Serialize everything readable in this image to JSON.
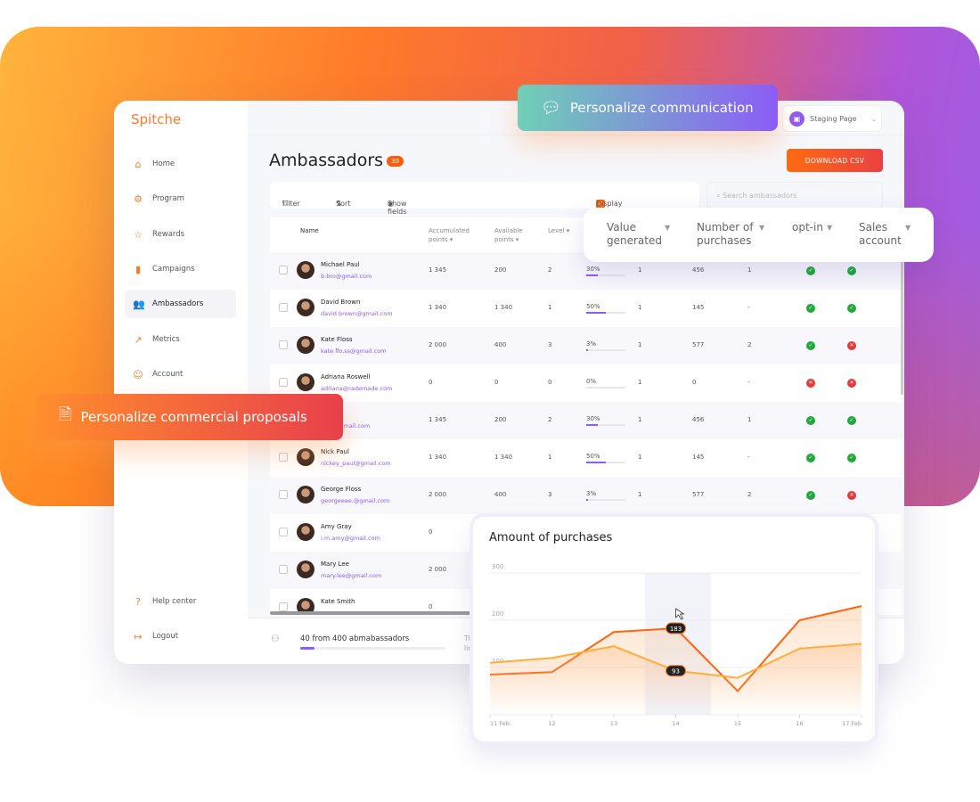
{
  "banners": {
    "communication": "Personalize communication",
    "proposals": "Personalize commercial proposals"
  },
  "app": {
    "logo": "Spitche",
    "staging": "Staging Page",
    "title": "Ambassadors",
    "count": "30",
    "download": "DOWNLOAD CSV"
  },
  "sidebar": {
    "items": [
      {
        "label": "Home",
        "icon": "⌂"
      },
      {
        "label": "Program",
        "icon": "⚙"
      },
      {
        "label": "Rewards",
        "icon": "☆"
      },
      {
        "label": "Campaigns",
        "icon": "▮"
      },
      {
        "label": "Ambassadors",
        "icon": "👥",
        "active": true
      },
      {
        "label": "Metrics",
        "icon": "↗"
      },
      {
        "label": "Account",
        "icon": "☺"
      }
    ],
    "bottom": [
      {
        "label": "Help center",
        "icon": "?"
      },
      {
        "label": "Logout",
        "icon": "↦"
      }
    ]
  },
  "toolbar": {
    "filter": "Filter",
    "sort": "Sort",
    "show_fields": "Show fields",
    "display_personal": "Display personal data",
    "search_placeholder": "Search ambassadors"
  },
  "table": {
    "headers": {
      "name": "Name",
      "accumulated": "Accumulated points",
      "available": "Available points",
      "level": "Level"
    },
    "floating_headers": [
      "Value generated",
      "Number of purchases",
      "opt-in",
      "Sales account"
    ],
    "rows": [
      {
        "name": "Michael Paul",
        "email": "b.bro@gmail.com",
        "acc": "1 345",
        "avail": "200",
        "level": "2",
        "progress": 30,
        "c1": "1",
        "purchases": "456",
        "c3": "1",
        "optin": true,
        "sales": true
      },
      {
        "name": "David Brown",
        "email": "david.brown@gmail.com",
        "acc": "1 340",
        "avail": "1 340",
        "level": "1",
        "progress": 50,
        "c1": "1",
        "purchases": "145",
        "c3": "-",
        "optin": true,
        "sales": true
      },
      {
        "name": "Kate Floss",
        "email": "kate.flo.ss@gmail.com",
        "acc": "2 000",
        "avail": "400",
        "level": "3",
        "progress": 3,
        "c1": "1",
        "purchases": "577",
        "c3": "2",
        "optin": true,
        "sales": false
      },
      {
        "name": "Adriana Roswell",
        "email": "adriana@rademade.com",
        "acc": "0",
        "avail": "0",
        "level": "0",
        "progress": 0,
        "c1": "1",
        "purchases": "0",
        "c3": "-",
        "optin": false,
        "sales": false
      },
      {
        "name": "mith",
        "email": "mith@gmail.com",
        "acc": "1 345",
        "avail": "200",
        "level": "2",
        "progress": 30,
        "c1": "1",
        "purchases": "456",
        "c3": "1",
        "optin": true,
        "sales": true
      },
      {
        "name": "Nick Paul",
        "email": "nickey_paul@gmail.com",
        "acc": "1 340",
        "avail": "1 340",
        "level": "1",
        "progress": 50,
        "c1": "1",
        "purchases": "145",
        "c3": "-",
        "optin": true,
        "sales": true
      },
      {
        "name": "George Floss",
        "email": "georgeeee.@gmail.com",
        "acc": "2 000",
        "avail": "400",
        "level": "3",
        "progress": 3,
        "c1": "1",
        "purchases": "577",
        "c3": "2",
        "optin": true,
        "sales": false
      },
      {
        "name": "Amy Gray",
        "email": "i.m.amy@gmail.com",
        "acc": "0"
      },
      {
        "name": "Mary Lee",
        "email": "mary.lee@gmail.com",
        "acc": "2 000"
      },
      {
        "name": "Kate Smith",
        "email": "",
        "acc": "0"
      }
    ]
  },
  "footer": {
    "text": "40 from 400 abmabassadors",
    "progress": 10,
    "trunc": "The lim"
  },
  "chart_data": {
    "type": "line",
    "title": "Amount of purchases",
    "categories": [
      "11 Feb.",
      "12",
      "13",
      "14",
      "15",
      "16",
      "17 Feb"
    ],
    "ylim": [
      0,
      300
    ],
    "yticks": [
      "300",
      "200",
      "100"
    ],
    "grid": true,
    "series": [
      {
        "values": [
          85,
          90,
          175,
          183,
          50,
          200,
          230
        ],
        "color": "#ff640f"
      },
      {
        "values": [
          110,
          120,
          145,
          93,
          78,
          140,
          150
        ],
        "color": "#ffae3a"
      }
    ],
    "highlight": "14",
    "tooltips": [
      "183",
      "93"
    ]
  }
}
